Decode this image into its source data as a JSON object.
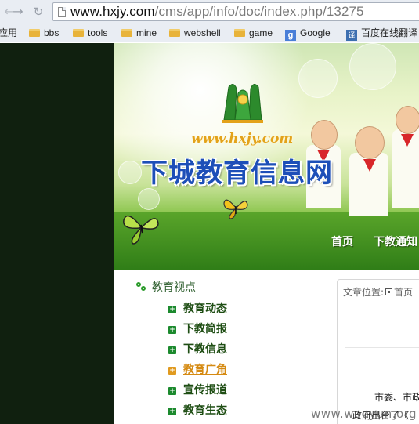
{
  "browser": {
    "url_host": "www.hxjy.com",
    "url_path": "/cms/app/info/doc/index.php/13275",
    "bookmarks": [
      {
        "label": "应用",
        "icon": "apps-icon"
      },
      {
        "label": "bbs",
        "icon": "folder-icon"
      },
      {
        "label": "tools",
        "icon": "folder-icon"
      },
      {
        "label": "mine",
        "icon": "folder-icon"
      },
      {
        "label": "webshell",
        "icon": "folder-icon"
      },
      {
        "label": "game",
        "icon": "folder-icon"
      },
      {
        "label": "Google",
        "icon": "google-icon"
      },
      {
        "label": "百度在线翻译",
        "icon": "translate-icon"
      }
    ]
  },
  "banner": {
    "domain": "www.hxjy.com",
    "site_name": "下城教育信息网"
  },
  "topnav": [
    "首页",
    "下教通知"
  ],
  "sidebar": {
    "title": "教育视点",
    "items": [
      {
        "label": "教育动态",
        "active": false
      },
      {
        "label": "下教简报",
        "active": false
      },
      {
        "label": "下教信息",
        "active": false
      },
      {
        "label": "教育广角",
        "active": true
      },
      {
        "label": "宣传报道",
        "active": false
      },
      {
        "label": "教育生态",
        "active": false
      }
    ]
  },
  "article": {
    "breadcrumb_prefix": "文章位置:",
    "breadcrumb_home": "首页",
    "line1": "市委、市政",
    "line2": "政府出台了《"
  },
  "watermark": "www.wooyun.org",
  "colors": {
    "sidebar_bg": "#10200f",
    "site_name": "#1d4fb8",
    "menu_text": "#1f4e14",
    "menu_active": "#d58a12"
  }
}
